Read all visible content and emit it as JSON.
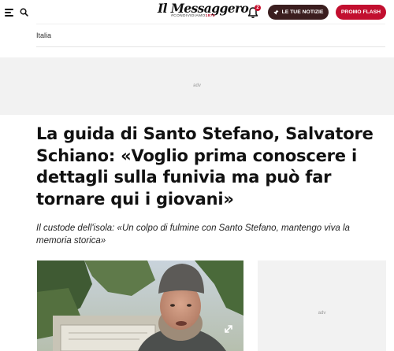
{
  "header": {
    "menu_icon": "hamburger-icon",
    "search_icon": "search-icon",
    "logo_name": "Il Messaggero",
    "logo_tagline_prefix": "#CONDIVIDIAMO",
    "logo_tagline_year": "1878",
    "notifications_count": "2",
    "notifications_icon": "bell-icon",
    "news_button_label": "LE TUE NOTIZIE",
    "news_button_icon": "pin-icon",
    "promo_button_label": "PROMO FLASH"
  },
  "breadcrumb": {
    "section": "Italia"
  },
  "ads": {
    "top_label": "adv",
    "side_label": "adv"
  },
  "article": {
    "headline": "La guida di Santo Stefano, Salvatore Schiano: «Voglio prima conoscere i dettagli sulla funivia ma può far tornare qui i giovani»",
    "subtitle": "Il custode dell'isola: «Un colpo di fulmine con Santo Stefano, mantengo viva la memoria storica»",
    "image_expand_icon": "expand-icon"
  },
  "colors": {
    "brand_red": "#c20f2f",
    "dark_button": "#3b1e1f",
    "ad_background": "#f2f2f2"
  }
}
